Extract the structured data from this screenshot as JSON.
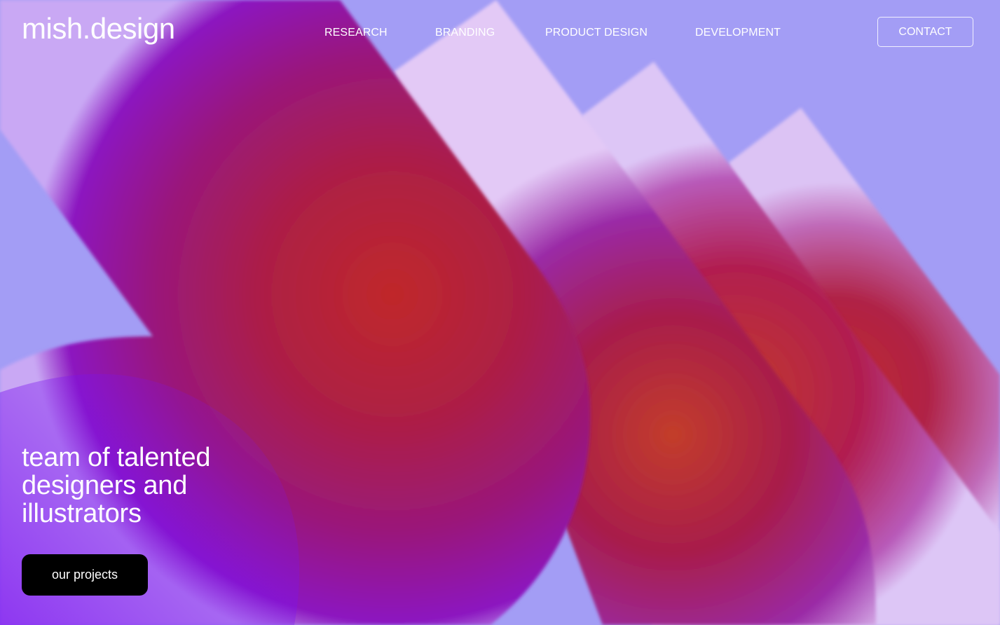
{
  "brand": {
    "logo_text": "mish.design"
  },
  "nav": {
    "items": [
      {
        "label": "RESEARCH"
      },
      {
        "label": "BRANDING"
      },
      {
        "label": "PRODUCT DESIGN"
      },
      {
        "label": "DEVELOPMENT"
      }
    ],
    "contact_label": "CONTACT"
  },
  "hero": {
    "headline": "team of talented designers and illustrators",
    "cta_label": "our projects"
  },
  "colors": {
    "background": "#a39df5",
    "shape_core": "#c0282a",
    "shape_mid": "#a5135f",
    "shape_edge": "#8a18c9",
    "shape_rim": "#e2c8f6",
    "text": "#ffffff",
    "cta_background": "#000000"
  }
}
